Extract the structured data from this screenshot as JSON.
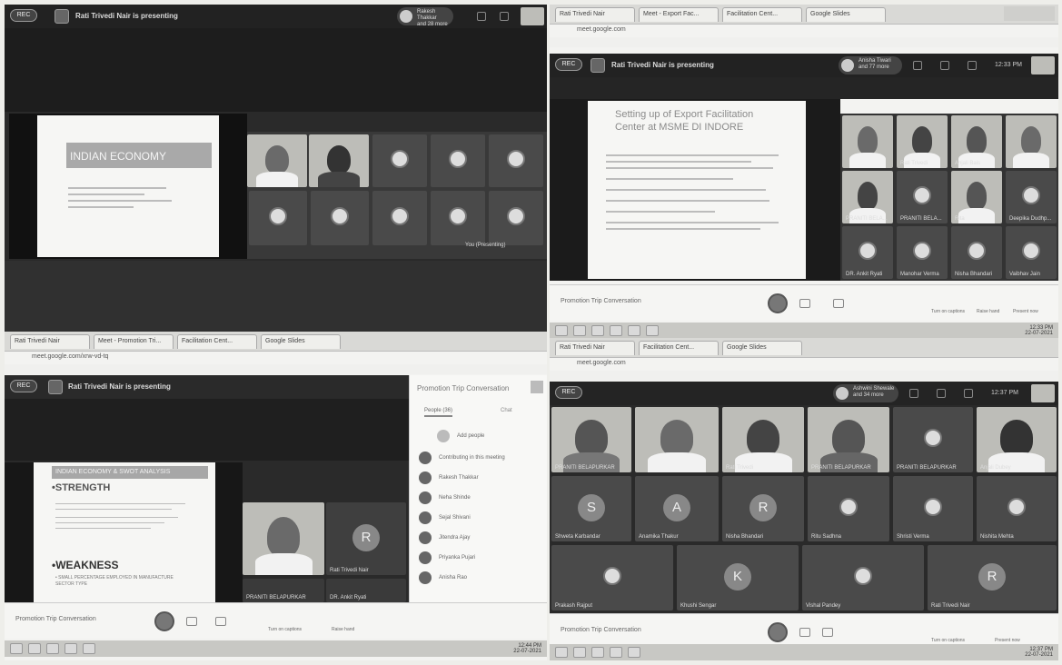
{
  "q1": {
    "presenting": "Rati Trivedi Nair is presenting",
    "chip": [
      "Rakesh Thakkar",
      "and 28 more"
    ],
    "slide_title": "INDIAN ECONOMY",
    "tile_label": "You (Presenting)"
  },
  "q2": {
    "tabs": [
      "Rati Trivedi Nair",
      "Meet - Export Fac...",
      "Facilitation Cent...",
      "Google Slides"
    ],
    "url": "meet.google.com",
    "presenting": "Rati Trivedi Nair is presenting",
    "chip": [
      "Anisha Tiwari",
      "and 77 more"
    ],
    "clock": "12:33 PM",
    "slide_title": [
      "Setting up of Export Facilitation",
      "Center at MSME DI INDORE"
    ],
    "tiles": [
      {
        "name": ""
      },
      {
        "name": "Rati Trivedi"
      },
      {
        "name": "Anjali Bais"
      },
      {
        "name": ""
      },
      {
        "name": "PRANITI BELA..."
      },
      {
        "name": "PRANITI BELA..."
      },
      {
        "name": "Rita"
      },
      {
        "name": "Deepika Dudhp..."
      },
      {
        "name": "DR. Ankit Ryati"
      },
      {
        "name": "Manohar Verma"
      },
      {
        "name": "Nisha Bhandari"
      },
      {
        "name": "Vaibhav Jain"
      }
    ],
    "meeting": "Promotion Trip Conversation",
    "ctrl_labels": [
      "Turn on captions",
      "Raise hand",
      "Present now"
    ],
    "taskbar_clock": [
      "12:33 PM",
      "22-07-2021"
    ]
  },
  "q3": {
    "tabs": [
      "Rati Trivedi Nair",
      "Meet - Promotion Tri...",
      "Facilitation Cent...",
      "Google Slides"
    ],
    "url": "meet.google.com/xrw-vd-tq",
    "presenting": "Rati Trivedi Nair is presenting",
    "slide_title": "INDIAN ECONOMY & SWOT ANALYSIS",
    "strength": "•STRENGTH",
    "weakness": "•WEAKNESS",
    "weak_line": "• SMALL PERCENTAGE EMPLOYED IN MANUFACTURE SECTOR TYPE",
    "tiles": [
      {
        "name": "",
        "letter": ""
      },
      {
        "name": "Rati Trivedi Nair",
        "letter": "R"
      },
      {
        "name": "PRANITI BELAPURKAR",
        "letter": ""
      },
      {
        "name": "DR. Ankit Ryati",
        "letter": ""
      }
    ],
    "panel_title": "Promotion Trip Conversation",
    "panel_tabs": [
      "People (36)",
      "Chat"
    ],
    "people": [
      "Add people",
      "Contributing in this meeting",
      "Rakesh Thakkar",
      "Neha Shinde",
      "Sejal Shivani",
      "Jitendra Ajay",
      "Priyanka Pujari",
      "Anisha Rao"
    ],
    "meeting": "Promotion Trip Conversation",
    "ctrl_labels": [
      "Turn on captions",
      "Raise hand"
    ],
    "taskbar_clock": [
      "12:44 PM",
      "22-07-2021"
    ]
  },
  "q4": {
    "tabs": [
      "Rati Trivedi Nair",
      "Facilitation Cent...",
      "Google Slides"
    ],
    "url": "meet.google.com",
    "chip": [
      "Ashwini Shewale",
      "and 34 more"
    ],
    "clock": "12:37 PM",
    "row1": [
      {
        "name": "PRANITI BELAPURKAR"
      },
      {
        "name": ""
      },
      {
        "name": "Rati Trivedi"
      },
      {
        "name": "PRANITI BELAPURKAR"
      },
      {
        "name": "PRANITI BELAPURKAR"
      },
      {
        "name": "Anjali Dubey"
      }
    ],
    "row2": [
      {
        "name": "Shweta Karbandar",
        "letter": "S"
      },
      {
        "name": "Anamika Thakur",
        "letter": "A"
      },
      {
        "name": "Nisha Bhandari",
        "letter": "R"
      },
      {
        "name": "Ritu Sadhna",
        "letter": ""
      },
      {
        "name": "Shristi Verma",
        "letter": ""
      },
      {
        "name": "Nishita Mehta",
        "letter": ""
      }
    ],
    "row3": [
      {
        "name": "Prakash Rajput",
        "letter": ""
      },
      {
        "name": "Khushi Sengar",
        "letter": "K"
      },
      {
        "name": "Vishal Pandey",
        "letter": ""
      },
      {
        "name": "Rati Trivedi Nair",
        "letter": "R"
      }
    ],
    "meeting": "Promotion Trip Conversation",
    "ctrl_labels": [
      "Turn on captions",
      "Present now"
    ],
    "taskbar_clock": [
      "12:37 PM",
      "22-07-2021"
    ]
  }
}
